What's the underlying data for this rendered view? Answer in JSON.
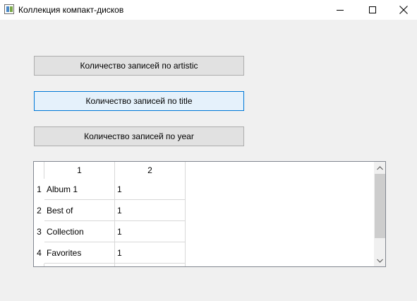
{
  "window": {
    "title": "Коллекция компакт-дисков",
    "icon": "app-window-icon"
  },
  "buttons": {
    "artistic": "Количество записей по artistic",
    "title": "Количество записей по title",
    "year": "Количество записей по year"
  },
  "table": {
    "columns": [
      "1",
      "2"
    ],
    "rows": [
      {
        "num": "1",
        "name": "Album 1",
        "count": "1"
      },
      {
        "num": "2",
        "name": "Best of",
        "count": "1"
      },
      {
        "num": "3",
        "name": "Collection",
        "count": "1"
      },
      {
        "num": "4",
        "name": "Favorites",
        "count": "1"
      }
    ]
  },
  "colors": {
    "window_bg": "#f0f0f0",
    "button_bg": "#e1e1e1",
    "focused_button_bg": "#e5f1fb",
    "focused_border": "#0078d7"
  }
}
